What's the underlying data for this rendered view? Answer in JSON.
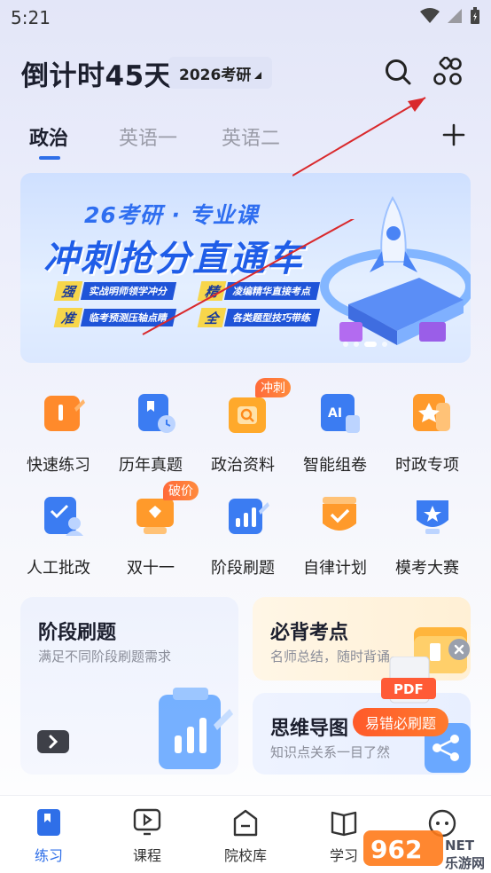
{
  "status_bar": {
    "time": "5:21"
  },
  "header": {
    "title": "倒计时45天",
    "year_selector": "2026考研"
  },
  "tabs": [
    {
      "label": "政治",
      "active": true
    },
    {
      "label": "英语一",
      "active": false
    },
    {
      "label": "英语二",
      "active": false
    }
  ],
  "banner": {
    "subtitle": "26考研 · 专业课",
    "title": "冲刺抢分直通车",
    "features": [
      {
        "tag": "强",
        "text": "实战明师领学冲分"
      },
      {
        "tag": "精",
        "text": "凌编精华直接考点"
      },
      {
        "tag": "准",
        "text": "临考预测压轴点睛"
      },
      {
        "tag": "全",
        "text": "各类题型技巧带练"
      }
    ]
  },
  "grid": [
    {
      "label": "快速练习",
      "icon": "quick-practice-icon",
      "color": "#ff8a2b"
    },
    {
      "label": "历年真题",
      "icon": "past-exams-icon",
      "color": "#3b7cf2"
    },
    {
      "label": "政治资料",
      "icon": "politics-materials-icon",
      "color": "#ffa92b",
      "badge": "冲刺"
    },
    {
      "label": "智能组卷",
      "icon": "ai-paper-icon",
      "color": "#3b7cf2"
    },
    {
      "label": "时政专项",
      "icon": "current-affairs-icon",
      "color": "#ff9a2b"
    },
    {
      "label": "人工批改",
      "icon": "manual-grading-icon",
      "color": "#3b7cf2"
    },
    {
      "label": "双十一",
      "icon": "double-eleven-icon",
      "color": "#ff9a2b",
      "badge": "破价"
    },
    {
      "label": "阶段刷题",
      "icon": "stage-practice-icon",
      "color": "#3b7cf2"
    },
    {
      "label": "自律计划",
      "icon": "self-discipline-icon",
      "color": "#ff9a2b"
    },
    {
      "label": "模考大赛",
      "icon": "mock-exam-icon",
      "color": "#3b7cf2"
    }
  ],
  "cards": {
    "left": {
      "title": "阶段刷题",
      "desc": "满足不同阶段刷题需求"
    },
    "right_top": {
      "title": "必背考点",
      "desc": "名师总结，随时背诵"
    },
    "right_bottom": {
      "title": "思维导图",
      "desc": "知识点关系一目了然"
    }
  },
  "overlay": {
    "pdf_label": "PDF",
    "button": "易错必刷题"
  },
  "bottom_nav": [
    {
      "label": "练习",
      "icon": "practice-icon",
      "active": true
    },
    {
      "label": "课程",
      "icon": "course-icon",
      "active": false
    },
    {
      "label": "院校库",
      "icon": "school-library-icon",
      "active": false
    },
    {
      "label": "学习",
      "icon": "study-icon",
      "active": false
    }
  ],
  "colors": {
    "accent": "#2f6fe8",
    "orange": "#ff6a3a"
  }
}
